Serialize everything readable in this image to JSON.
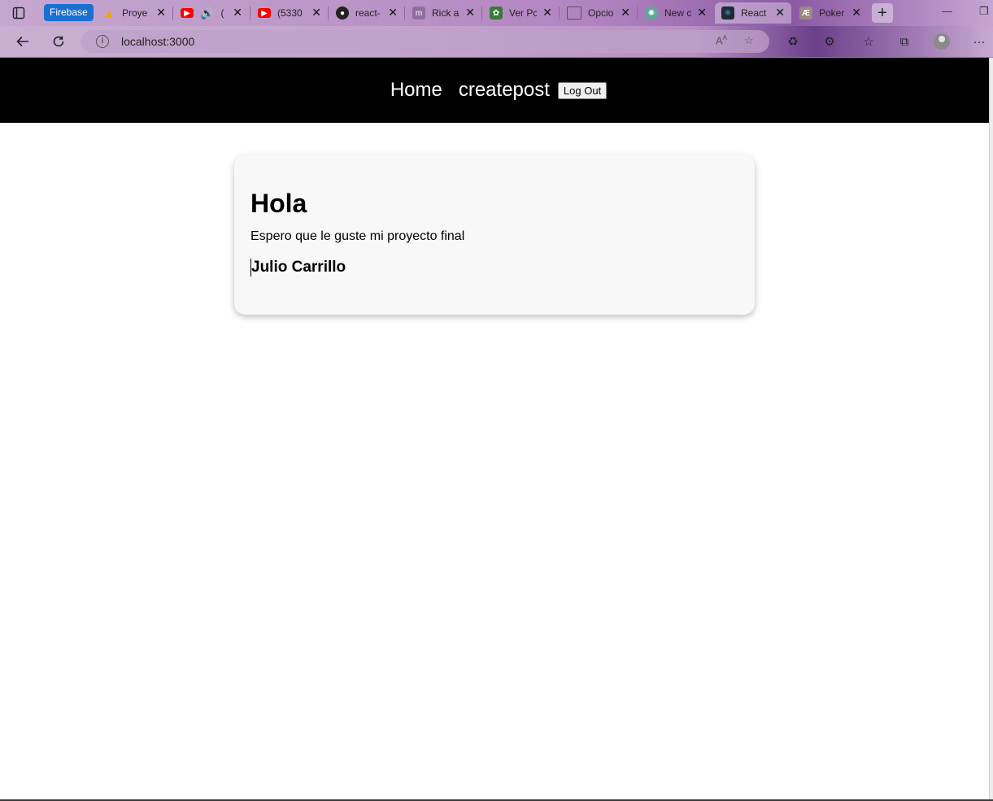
{
  "browser": {
    "tabs": [
      {
        "label": "Firebase",
        "favicon": "firebase-icon"
      },
      {
        "label": "Proye",
        "favicon": "firebase-flame-icon"
      },
      {
        "label": "(",
        "favicon": "youtube-icon",
        "audio": true
      },
      {
        "label": "(5330",
        "favicon": "youtube-icon"
      },
      {
        "label": "react-",
        "favicon": "github-icon"
      },
      {
        "label": "Rick a",
        "favicon": "medium-m-icon"
      },
      {
        "label": "Ver Pc",
        "favicon": "app-icon"
      },
      {
        "label": "Opcio",
        "favicon": "document-icon"
      },
      {
        "label": "New c",
        "favicon": "chatgpt-icon"
      },
      {
        "label": "React",
        "favicon": "react-icon",
        "active": true
      },
      {
        "label": "Poker",
        "favicon": "ae-icon"
      }
    ],
    "address": {
      "url": "localhost:3000"
    },
    "colors": {
      "youtube": "#ff0000",
      "firebase_pill": "#1b6fd1"
    }
  },
  "nav": {
    "home": "Home",
    "createpost": "createpost",
    "logout": "Log Out"
  },
  "post": {
    "title": "Hola",
    "body": "Espero que le guste mi proyecto final",
    "author": "Julio Carrillo"
  }
}
